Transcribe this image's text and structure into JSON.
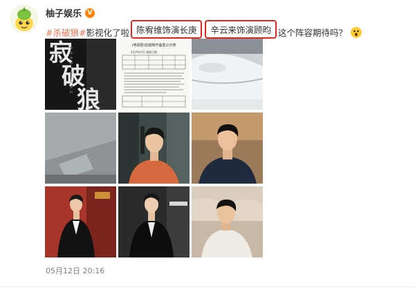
{
  "post": {
    "username": "柚子娱乐",
    "verified_badge": "V",
    "tag1": "#杀破狼#",
    "text1": "影视化了啦",
    "highlight1": "陈宥维饰演长庚",
    "highlight2": "辛云来饰演顾昀",
    "text2": "这个阵容期待吗？",
    "timestamp": "05月12日 20:16"
  },
  "images": {
    "poster": {
      "title_chars": [
        "寂",
        "破",
        "狼"
      ],
      "subtitle": "S H A O  P O  L A N G"
    },
    "document": {
      "heading": "(电视剧)拍摄制作备案公示表",
      "meta": "2019年5月   填报日期"
    }
  },
  "icons": [
    "avatar-mascot-icon",
    "verified-badge-icon",
    "surprised-emoji-icon"
  ],
  "colors": {
    "tag": "#eb7350",
    "highlight_border": "#e0261c",
    "badge": "#ff8200",
    "timestamp": "#808080"
  }
}
